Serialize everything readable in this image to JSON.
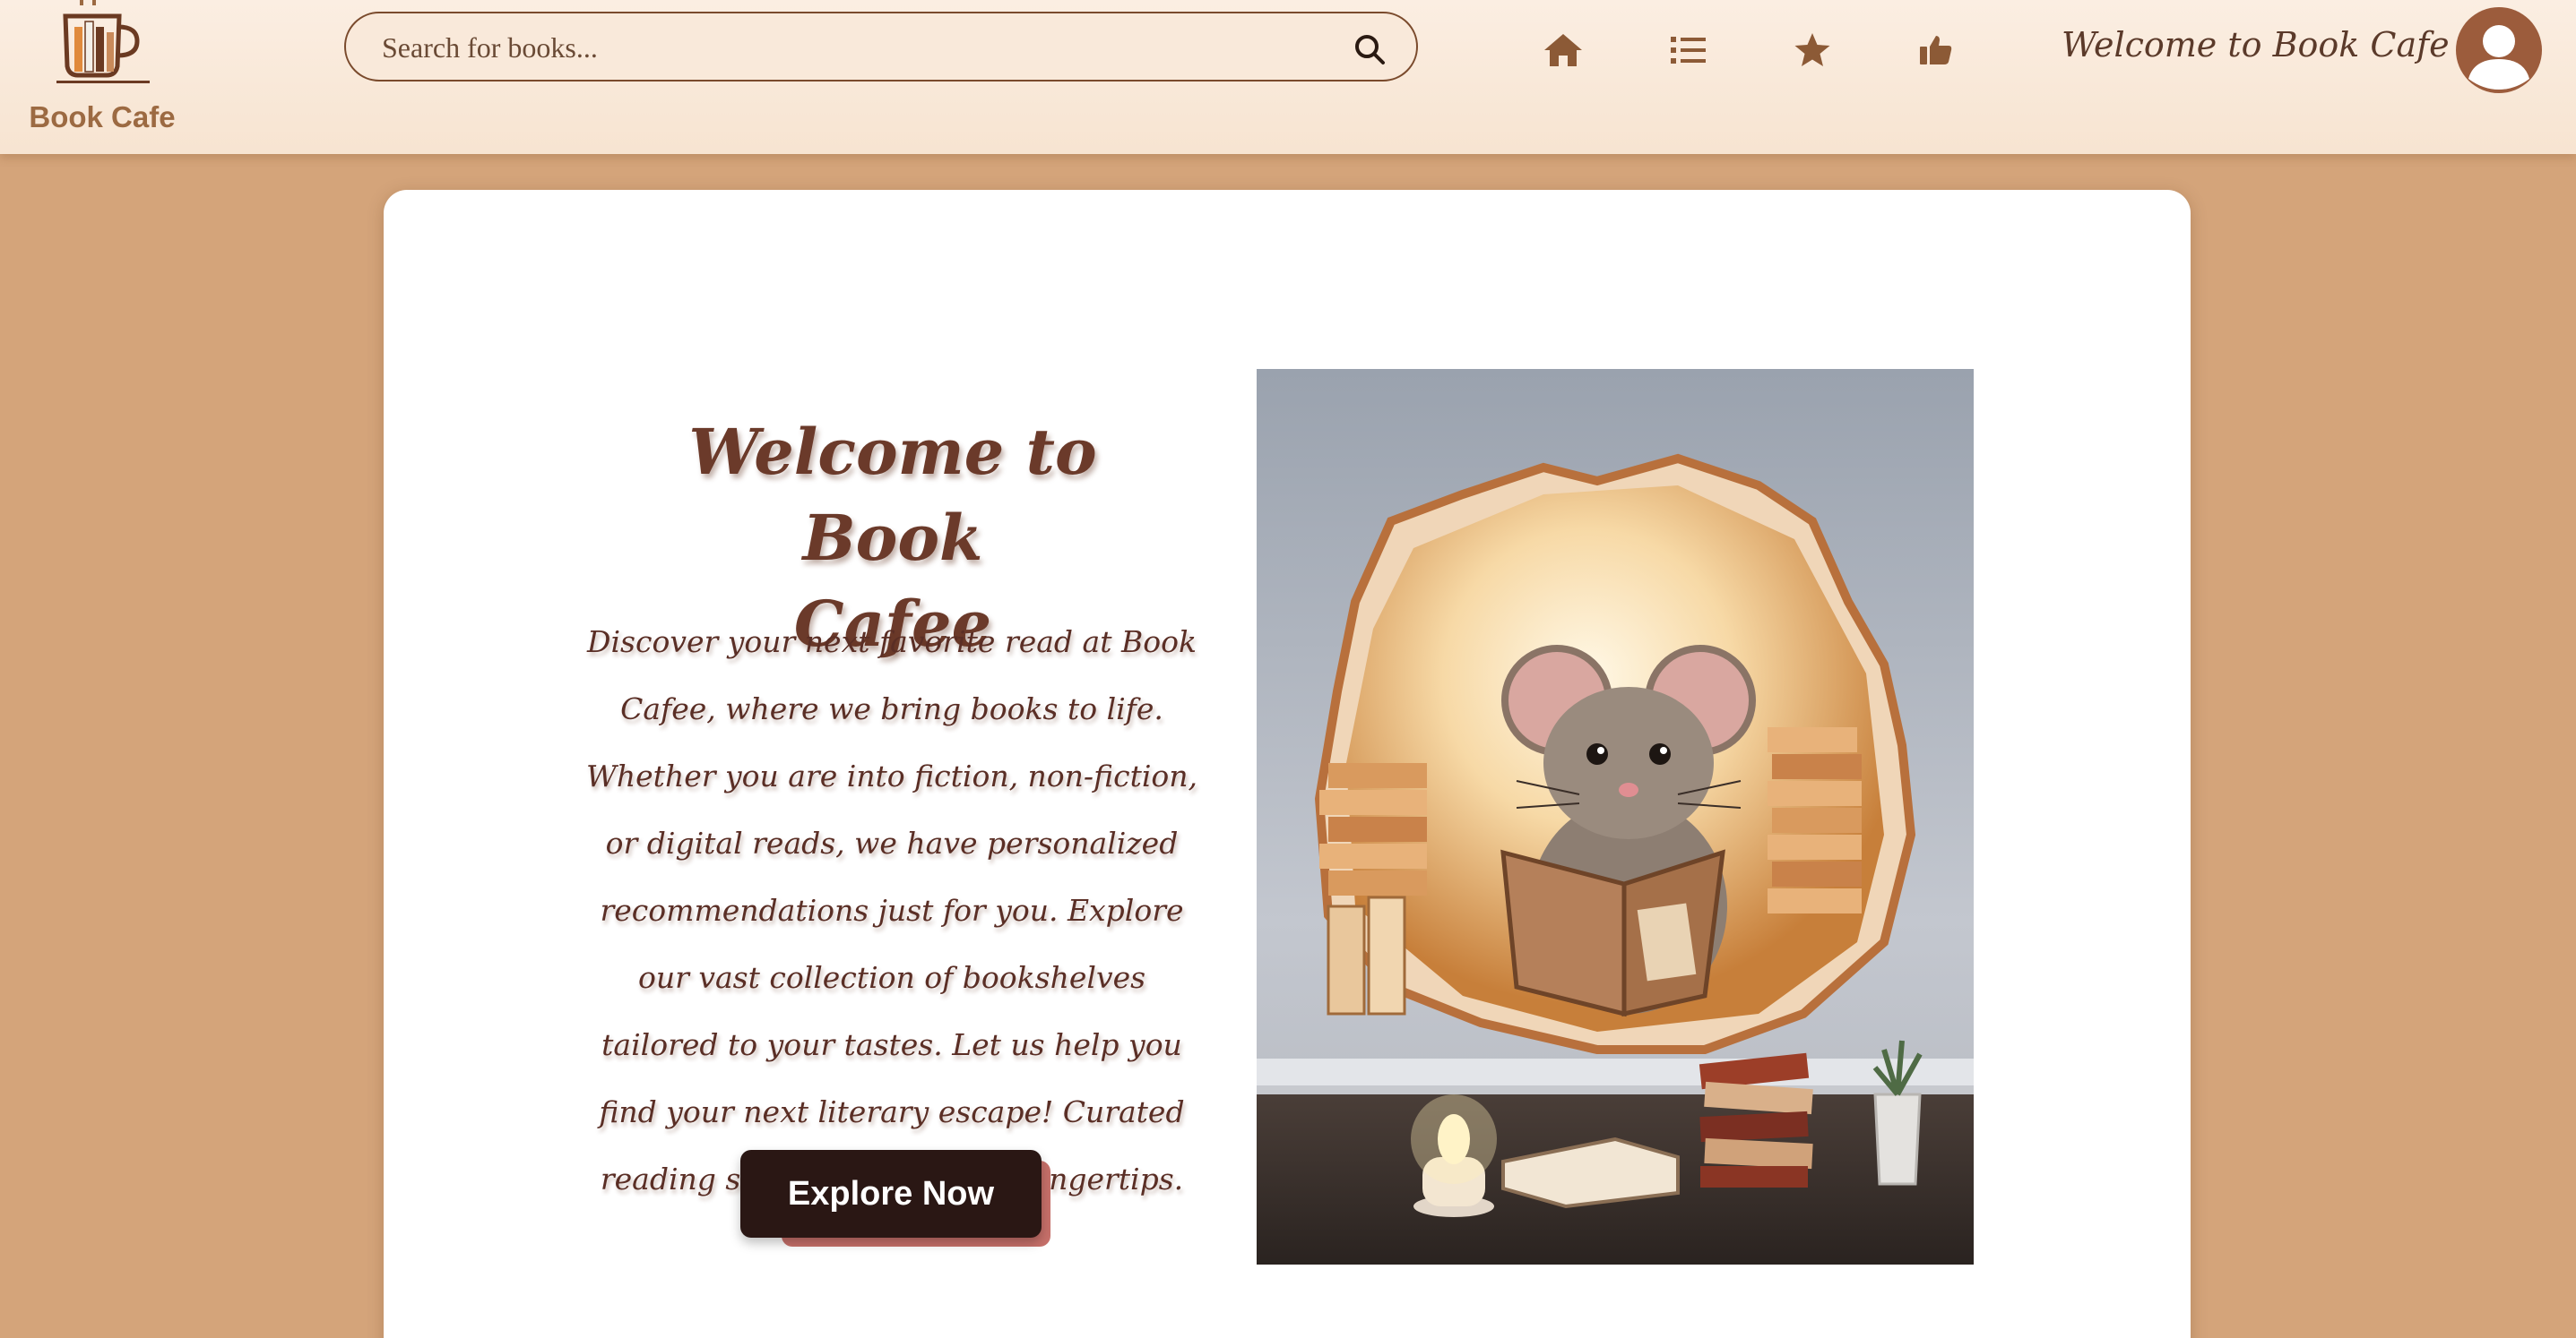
{
  "brand": {
    "name": "Book Cafe",
    "logo_icon": "coffee-cup-books-icon"
  },
  "search": {
    "placeholder": "Search for books...",
    "icon": "search-icon"
  },
  "nav": {
    "items": [
      {
        "icon": "home-icon"
      },
      {
        "icon": "list-icon"
      },
      {
        "icon": "star-icon"
      },
      {
        "icon": "thumbs-up-icon"
      }
    ],
    "welcome": "Welcome to Book Cafe",
    "avatar_icon": "user-avatar-icon"
  },
  "hero": {
    "title_line1": "Welcome to Book",
    "title_line2": "Cafee",
    "description": "Discover your next favorite read at Book Cafee, where we bring books to life. Whether you are into fiction, non-fiction, or digital reads, we have personalized recommendations just for you. Explore our vast collection of bookshelves tailored to your tastes. Let us help you find your next literary escape! Curated reading suggestions at your fingertips.",
    "button_label": "Explore Now",
    "image_icon": "mouse-reading-book-illustration"
  },
  "colors": {
    "page_background": "#d4a47a",
    "header_background": "#fbeee2",
    "brand_text": "#9c6a42",
    "nav_icon": "#8c5a36",
    "title_text": "#6b3a2a",
    "button_background": "#2a1714",
    "button_shadow": "#c7706a",
    "avatar": "#9c5c3c"
  }
}
